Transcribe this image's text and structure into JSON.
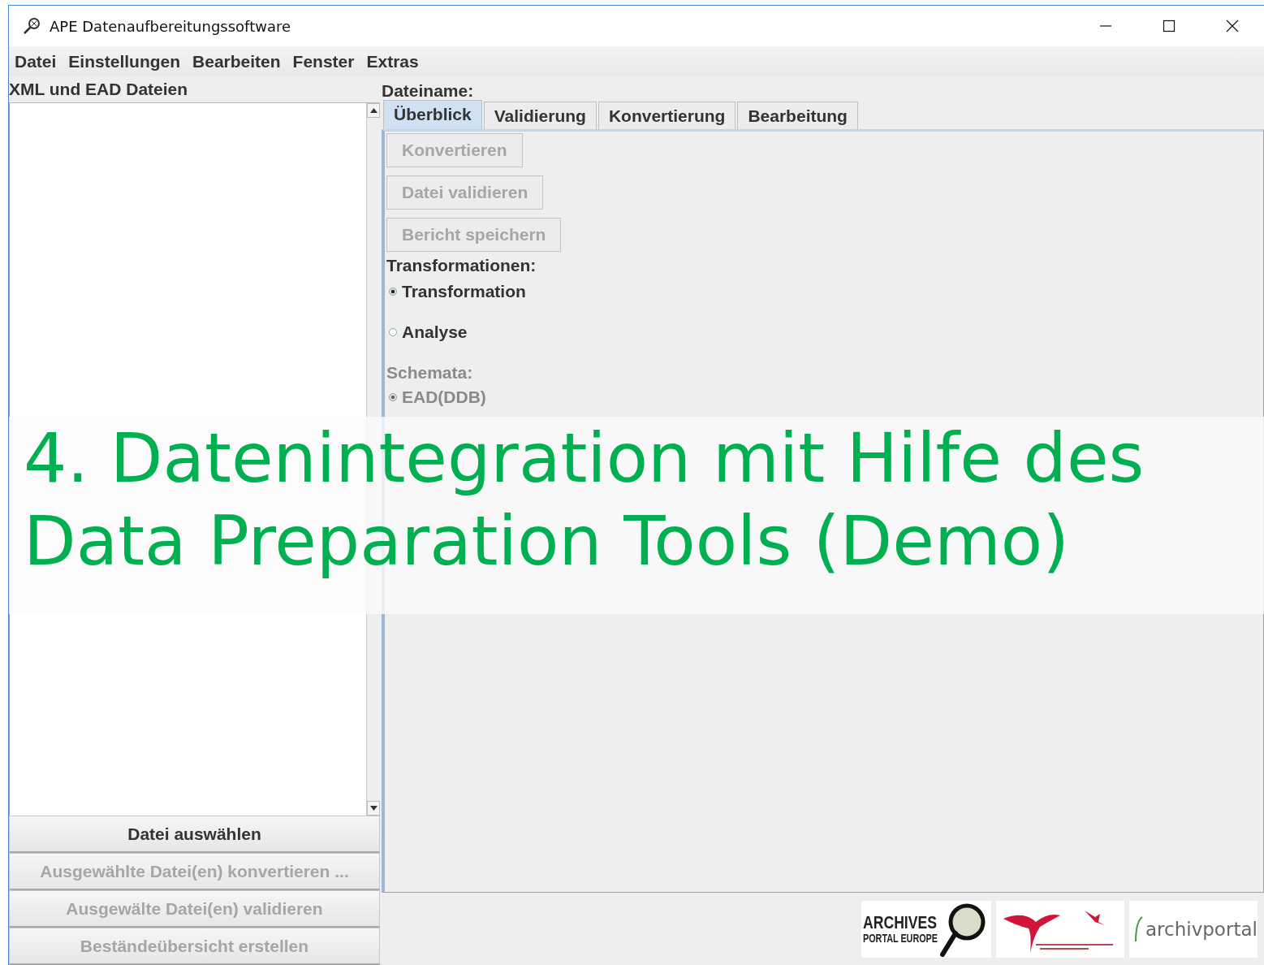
{
  "window": {
    "title": "APE Datenaufbereitungssoftware"
  },
  "menu": [
    "Datei",
    "Einstellungen",
    "Bearbeiten",
    "Fenster",
    "Extras"
  ],
  "file_panel": {
    "title": "XML und EAD Dateien",
    "buttons": [
      {
        "label": "Datei auswählen",
        "disabled": false
      },
      {
        "label": "Ausgewählte Datei(en) konvertieren ...",
        "disabled": true
      },
      {
        "label": "Ausgewälte Datei(en) validieren",
        "disabled": true
      },
      {
        "label": "Beständeübersicht erstellen",
        "disabled": true
      }
    ]
  },
  "file_name_label": "Dateiname:",
  "tabs": [
    {
      "label": "Überblick",
      "selected": true
    },
    {
      "label": "Validierung",
      "selected": false
    },
    {
      "label": "Konvertierung",
      "selected": false
    },
    {
      "label": "Bearbeitung",
      "selected": false
    }
  ],
  "actions": [
    {
      "label": "Konvertieren",
      "disabled": true
    },
    {
      "label": "Datei validieren",
      "disabled": true
    },
    {
      "label": "Bericht speichern",
      "disabled": true
    }
  ],
  "transformations": {
    "label": "Transformationen:",
    "disabled": false,
    "options": [
      {
        "label": "Transformation",
        "selected": true
      },
      {
        "label": "Analyse",
        "selected": false
      }
    ]
  },
  "schemata": {
    "label": "Schemata:",
    "disabled": true,
    "options": [
      {
        "label": "EAD(DDB)",
        "selected": true
      }
    ]
  },
  "logos": [
    {
      "kind": "ape",
      "text": "ARCHIVES",
      "subtext": "PORTAL EUROPE"
    },
    {
      "kind": "ddb"
    },
    {
      "kind": "archivportal",
      "text": "archivportal"
    }
  ],
  "overlay": {
    "title_lines": [
      "4. Datenintegration mit Hilfe des",
      "Data Preparation Tools (Demo)"
    ]
  }
}
